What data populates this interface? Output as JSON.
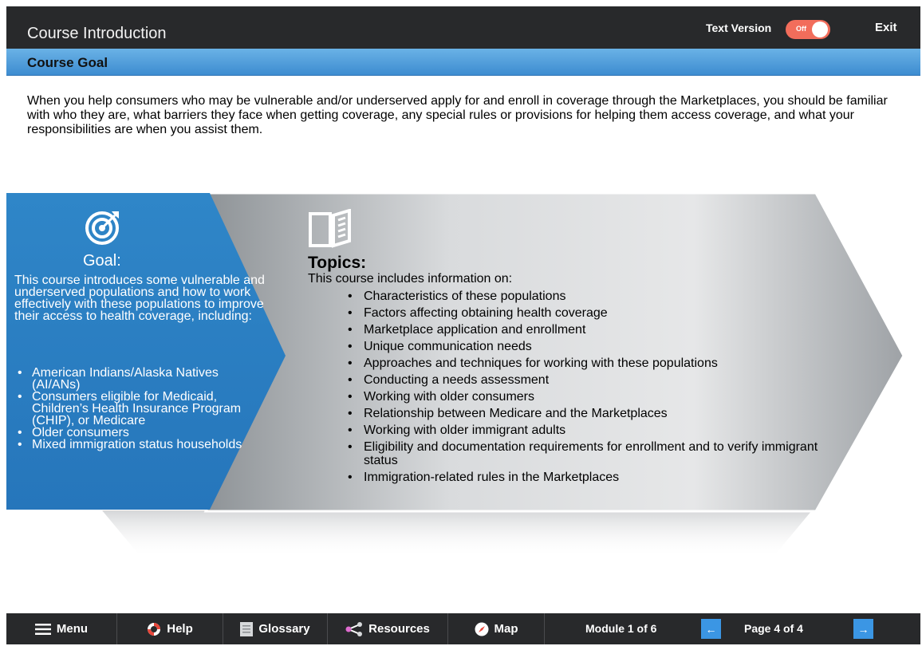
{
  "header": {
    "title": "Course Introduction",
    "text_version_label": "Text Version",
    "toggle_state": "Off",
    "exit_label": "Exit"
  },
  "section": {
    "title": "Course Goal"
  },
  "intro": "When you help consumers who may be vulnerable and/or underserved apply for and enroll in coverage through the Marketplaces, you should be familiar with who they are, what barriers they face when getting coverage, any special rules or provisions for helping them access coverage, and what your responsibilities are when you assist them.",
  "goal": {
    "icon": "target-icon",
    "heading": "Goal:",
    "text": "This course introduces some vulnerable and underserved populations and how to work effectively with these populations to improve their access to health coverage, including:",
    "items": [
      "American Indians/Alaska Natives (AI/ANs)",
      "Consumers eligible for Medicaid, Children’s Health Insurance Program (CHIP), or Medicare",
      "Older consumers",
      "Mixed immigration status households"
    ]
  },
  "topics": {
    "icon": "book-icon",
    "heading": "Topics:",
    "intro": "This course includes information on:",
    "items": [
      "Characteristics of these populations",
      "Factors affecting obtaining health coverage",
      "Marketplace application and enrollment",
      "Unique communication needs",
      "Approaches and techniques for working with these populations",
      "Conducting a needs assessment",
      "Working with older consumers",
      "Relationship between Medicare and the Marketplaces",
      "Working with older immigrant adults",
      "Eligibility and documentation requirements for enrollment and to verify immigrant status",
      "Immigration-related rules in the Marketplaces"
    ]
  },
  "footer": {
    "menu_label": "Menu",
    "help_label": "Help",
    "glossary_label": "Glossary",
    "resources_label": "Resources",
    "map_label": "Map",
    "module_indicator": "Module 1 of 6",
    "page_indicator": "Page 4 of 4"
  },
  "colors": {
    "header_bg": "#28292b",
    "section_bar": "#4a9ad9",
    "goal_panel": "#2a81c4",
    "toggle": "#f26d5b",
    "nav_arrow": "#3b96e4"
  }
}
